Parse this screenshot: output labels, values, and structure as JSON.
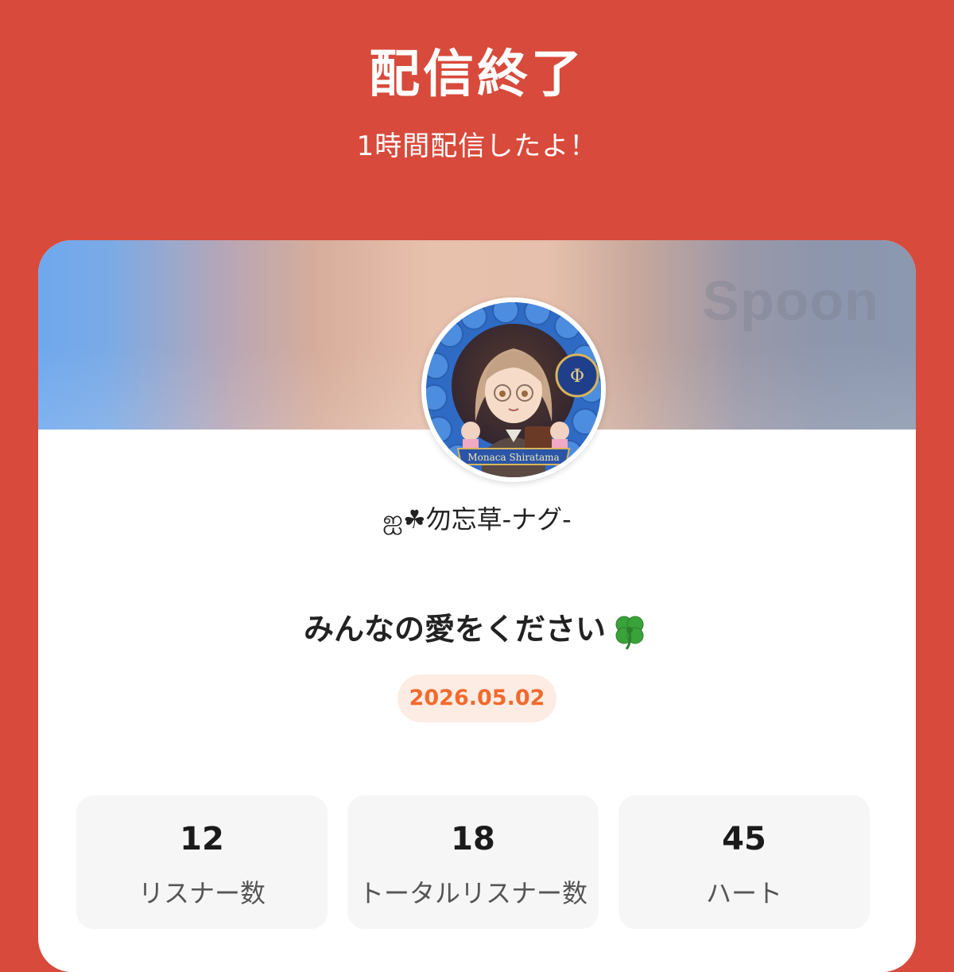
{
  "header": {
    "title": "配信終了",
    "subtitle": "1時間配信したよ！"
  },
  "card": {
    "brand_watermark": "Spoon",
    "avatar_caption": "Monaca Shiratama",
    "username": "ஐ☘勿忘草-ナグ-",
    "live_title": "みんなの愛をください",
    "title_icon": "four-leaf-clover-icon",
    "date": "2026.05.02"
  },
  "stats": [
    {
      "value": "12",
      "label": "リスナー数"
    },
    {
      "value": "18",
      "label": "トータルリスナー数"
    },
    {
      "value": "45",
      "label": "ハート"
    }
  ],
  "colors": {
    "background": "#d84a3b",
    "date_text": "#f26a2d",
    "date_badge_bg": "#fdece4",
    "stat_box_bg": "#f6f6f6"
  }
}
